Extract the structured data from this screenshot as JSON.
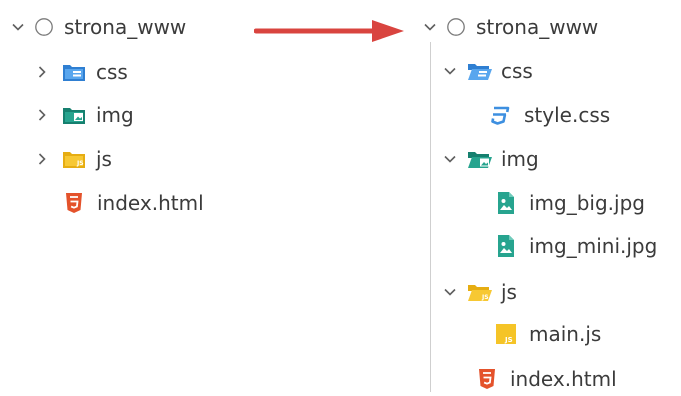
{
  "left_tree": {
    "root": {
      "label": "strona_www",
      "state": "collapsed"
    },
    "items": [
      {
        "label": "css",
        "type": "folder",
        "icon": "css-folder-icon",
        "state": "collapsed"
      },
      {
        "label": "img",
        "type": "folder",
        "icon": "image-folder-icon",
        "state": "collapsed"
      },
      {
        "label": "js",
        "type": "folder",
        "icon": "js-folder-icon",
        "state": "collapsed"
      },
      {
        "label": "index.html",
        "type": "file",
        "icon": "html5-icon"
      }
    ]
  },
  "right_tree": {
    "root": {
      "label": "strona_www",
      "state": "expanded"
    },
    "items": [
      {
        "label": "css",
        "type": "folder",
        "icon": "css-folder-open-icon",
        "state": "expanded"
      },
      {
        "label": "style.css",
        "type": "file",
        "icon": "css3-icon"
      },
      {
        "label": "img",
        "type": "folder",
        "icon": "image-folder-open-icon",
        "state": "expanded"
      },
      {
        "label": "img_big.jpg",
        "type": "file",
        "icon": "image-file-icon"
      },
      {
        "label": "img_mini.jpg",
        "type": "file",
        "icon": "image-file-icon"
      },
      {
        "label": "js",
        "type": "folder",
        "icon": "js-folder-open-icon",
        "state": "expanded"
      },
      {
        "label": "main.js",
        "type": "file",
        "icon": "javascript-icon"
      },
      {
        "label": "index.html",
        "type": "file",
        "icon": "html5-icon"
      }
    ]
  },
  "colors": {
    "arrow": "#d9443f",
    "css_blue": "#3d8fe0",
    "img_teal": "#21a08d",
    "js_yellow": "#f5c427",
    "html_orange": "#e4522b",
    "chevron": "#5f5f5f"
  }
}
